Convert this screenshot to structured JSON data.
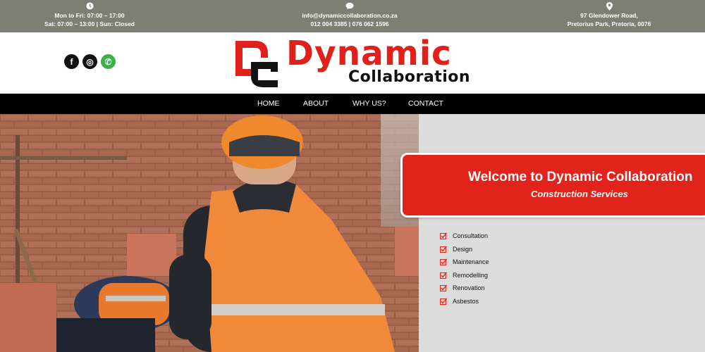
{
  "topbar": {
    "hours": {
      "icon": "clock-icon",
      "line1": "Mon to Fri: 07:00 – 17:00",
      "line2": "Sat: 07:00 – 13:00 | Sun: Closed"
    },
    "contact": {
      "icon": "chat-icon",
      "line1": "info@dynamiccollaboration.co.za",
      "line2": "012 004 3385 | 076 062 1596"
    },
    "address": {
      "icon": "map-pin-icon",
      "line1": "97 Glendower Road,",
      "line2": "Pretorius Park, Pretoria, 0076"
    }
  },
  "socials": [
    {
      "name": "facebook-icon",
      "glyph": "f"
    },
    {
      "name": "instagram-icon",
      "glyph": "◎"
    },
    {
      "name": "whatsapp-icon",
      "glyph": "✆"
    }
  ],
  "logo": {
    "word": "Dynamic",
    "sub": "Collaboration"
  },
  "nav": {
    "home": "HOME",
    "about": "ABOUT",
    "why": "WHY US?",
    "contact": "CONTACT"
  },
  "hero": {
    "welcome_title": "Welcome to Dynamic Collaboration",
    "welcome_subtitle": "Construction Services",
    "services": [
      "Consultation",
      "Design",
      "Maintenance",
      "Remodelling",
      "Renovation",
      "Asbestos"
    ]
  },
  "colors": {
    "accent": "#e0241c",
    "topbar": "#7d7f72",
    "nav": "#000000",
    "panel": "#dcdcdc"
  }
}
